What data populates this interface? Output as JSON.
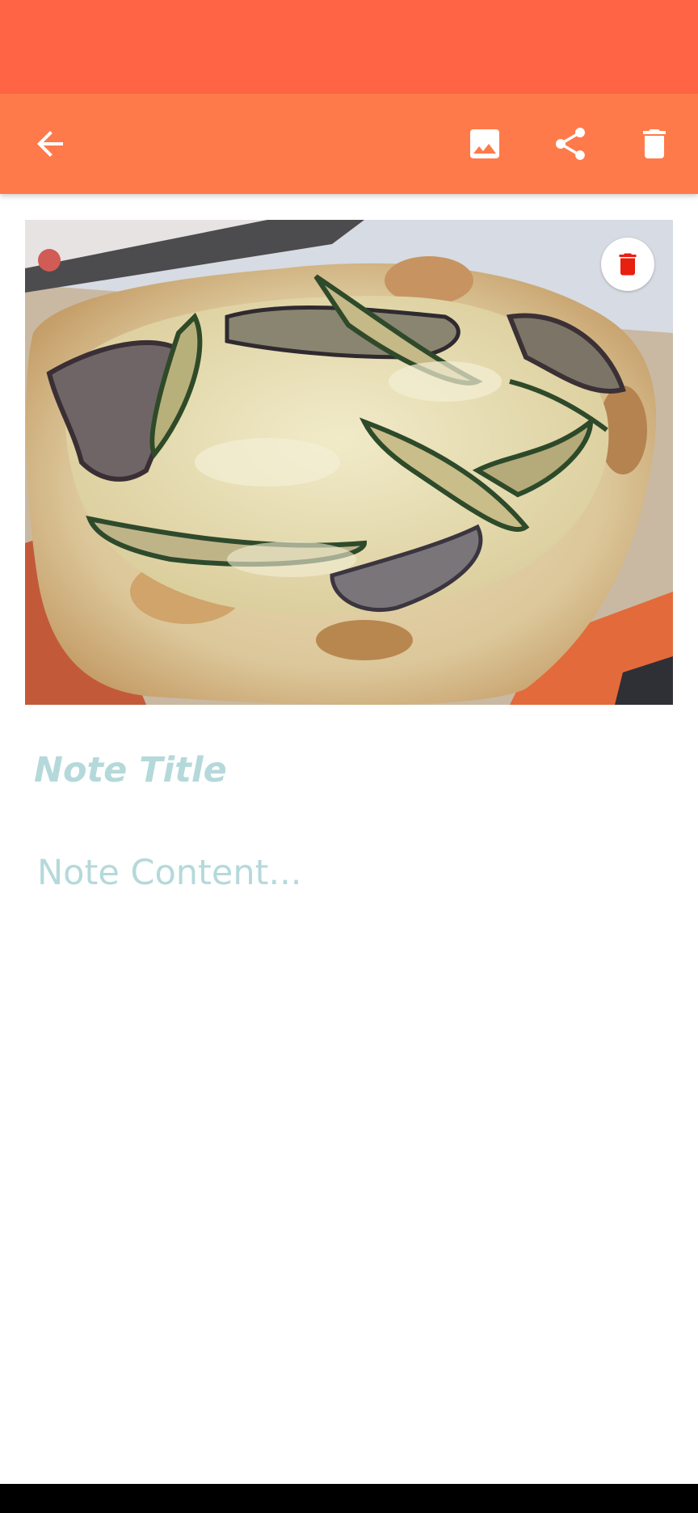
{
  "colors": {
    "status_bar": "#ff6545",
    "toolbar": "#ff7a4a",
    "placeholder_text": "#b5d9da",
    "delete_accent": "#e8200f"
  },
  "toolbar": {
    "back_icon": "arrow-back-icon",
    "image_icon": "image-icon",
    "share_icon": "share-icon",
    "delete_icon": "trash-icon"
  },
  "note": {
    "image_alt": "Pizza with grilled eggplant and zucchini",
    "remove_image_icon": "trash-icon",
    "title_placeholder": "Note Title",
    "content_placeholder": "Note Content..."
  }
}
